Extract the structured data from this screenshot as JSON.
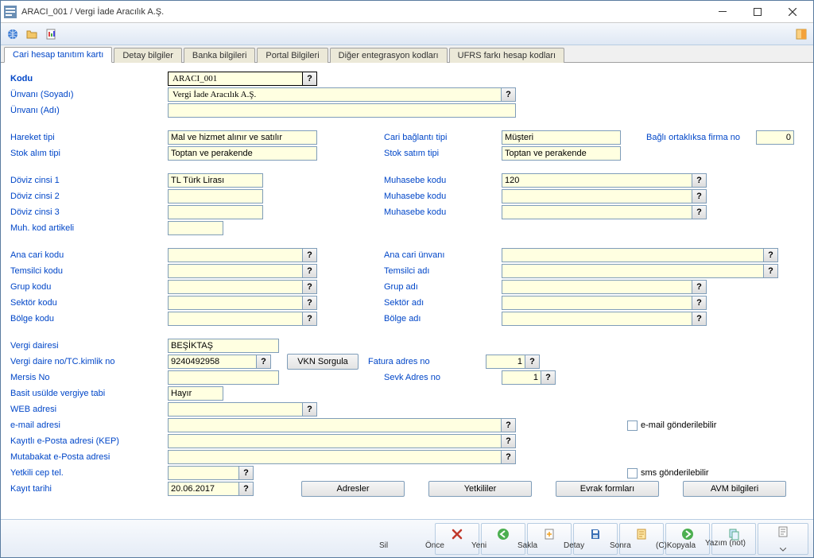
{
  "window": {
    "title": "ARACI_001 / Vergi İade Aracılık A.Ş."
  },
  "tabs": [
    "Cari hesap tanıtım kartı",
    "Detay bilgiler",
    "Banka bilgileri",
    "Portal Bilgileri",
    "Diğer entegrasyon kodları",
    "UFRS farkı hesap kodları"
  ],
  "labels": {
    "kodu": "Kodu",
    "unvan_soyadi": "Ünvanı (Soyadı)",
    "unvan_adi": "Ünvanı (Adı)",
    "hareket_tipi": "Hareket tipi",
    "stok_alim_tipi": "Stok alım tipi",
    "cari_baglanti_tipi": "Cari bağlantı tipi",
    "stok_satim_tipi": "Stok satım tipi",
    "bagli_ortaklik": "Bağlı ortaklıksa firma no",
    "doviz1": "Döviz cinsi 1",
    "doviz2": "Döviz cinsi 2",
    "doviz3": "Döviz cinsi 3",
    "muhkod_artikeli": "Muh. kod artikeli",
    "muhasebe_kodu": "Muhasebe kodu",
    "ana_cari_kodu": "Ana cari kodu",
    "ana_cari_unvani": "Ana cari ünvanı",
    "temsilci_kodu": "Temsilci kodu",
    "temsilci_adi": "Temsilci adı",
    "grup_kodu": "Grup kodu",
    "grup_adi": "Grup adı",
    "sektor_kodu": "Sektör kodu",
    "sektor_adi": "Sektör adı",
    "bolge_kodu": "Bölge kodu",
    "bolge_adi": "Bölge adı",
    "vergi_dairesi": "Vergi dairesi",
    "vergi_no": "Vergi daire no/TC.kimlik no",
    "mersis": "Mersis No",
    "basit_usul": "Basit usülde vergiye tabi",
    "web": "WEB adresi",
    "email": "e-mail adresi",
    "kep": "Kayıtlı e-Posta adresi (KEP)",
    "mutabakat": "Mutabakat e-Posta adresi",
    "yetkili_cep": "Yetkili cep tel.",
    "kayit_tarihi": "Kayıt tarihi",
    "fatura_adres": "Fatura adres no",
    "sevk_adres": "Sevk Adres no",
    "email_gonder": "e-mail gönderilebilir",
    "sms_gonder": "sms gönderilebilir"
  },
  "values": {
    "kodu": "ARACI_001",
    "unvan_soyadi": "Vergi İade Aracılık A.Ş.",
    "unvan_adi": "",
    "hareket_tipi": "Mal ve hizmet alınır ve satılır",
    "stok_alim_tipi": "Toptan ve perakende",
    "cari_baglanti_tipi": "Müşteri",
    "stok_satim_tipi": "Toptan ve perakende",
    "bagli_ortaklik": "0",
    "doviz1": "TL  Türk Lirası",
    "muhasebe_kodu1": "120",
    "vergi_dairesi": "BEŞİKTAŞ",
    "vergi_no": "9240492958",
    "basit_usul": "Hayır",
    "kayit_tarihi": "20.06.2017",
    "fatura_adres": "1",
    "sevk_adres": "1"
  },
  "buttons": {
    "vkn_sorgula": "VKN Sorgula",
    "adresler": "Adresler",
    "yetkililer": "Yetkililer",
    "evrak_formlari": "Evrak formları",
    "avm": "AVM bilgileri"
  },
  "footer": {
    "sil": "Sil",
    "once": "Önce",
    "yeni": "Yeni",
    "sakla": "Sakla",
    "detay": "Detay",
    "sonra": "Sonra",
    "kopyala": "(C)Kopyala",
    "yazim": "Yazım (not)"
  }
}
